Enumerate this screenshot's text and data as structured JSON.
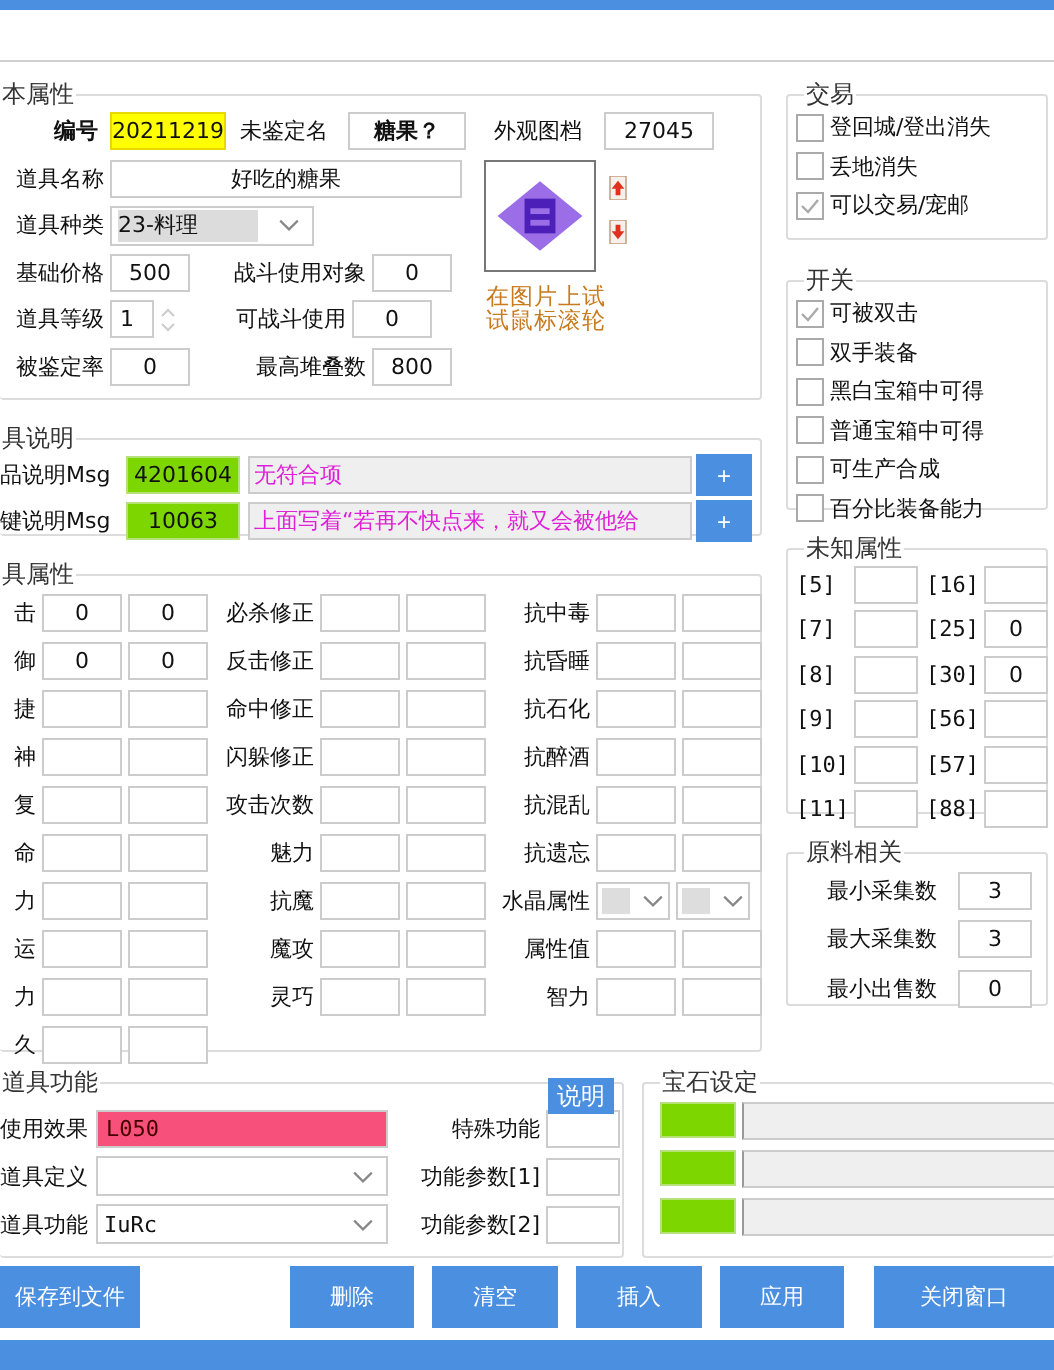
{
  "basic": {
    "title": "本属性",
    "id_label": "编号",
    "id": "20211219",
    "unidentified_label": "未鉴定名",
    "unidentified": "糖果？",
    "appearance_label": "外观图档",
    "appearance": "27045",
    "name_label": "道具名称",
    "name": "好吃的糖果",
    "type_label": "道具种类",
    "type": "23-料理",
    "price_label": "基础价格",
    "price": "500",
    "battle_target_label": "战斗使用对象",
    "battle_target": "0",
    "level_label": "道具等级",
    "level_value": "1",
    "battle_use_label": "可战斗使用",
    "battle_use": "0",
    "identify_rate_label": "被鉴定率",
    "identify_rate": "0",
    "max_stack_label": "最高堆叠数",
    "max_stack": "800",
    "image_hint": "在图片上试试鼠标滚轮"
  },
  "trade": {
    "title": "交易",
    "options": [
      {
        "label": "登回城/登出消失",
        "checked": false
      },
      {
        "label": "丢地消失",
        "checked": false
      },
      {
        "label": "可以交易/宠邮",
        "checked": true
      }
    ]
  },
  "switches": {
    "title": "开关",
    "options": [
      {
        "label": "可被双击",
        "checked": true
      },
      {
        "label": "双手装备",
        "checked": false
      },
      {
        "label": "黑白宝箱中可得",
        "checked": false
      },
      {
        "label": "普通宝箱中可得",
        "checked": false
      },
      {
        "label": "可生产合成",
        "checked": false
      },
      {
        "label": "百分比装备能力",
        "checked": false
      }
    ]
  },
  "description": {
    "title": "具说明",
    "rows": [
      {
        "label": "品说明Msg",
        "code": "4201604",
        "text": "无符合项",
        "button": "+"
      },
      {
        "label": "键说明Msg",
        "code": "10063",
        "text": "上面写着“若再不快点来，就又会被他给",
        "button": "+"
      }
    ]
  },
  "attributes": {
    "title": "具属性",
    "columns": [
      [
        {
          "label": "击",
          "values": [
            "0",
            "0"
          ]
        },
        {
          "label": "御",
          "values": [
            "0",
            "0"
          ]
        },
        {
          "label": "捷"
        },
        {
          "label": "神"
        },
        {
          "label": "复"
        },
        {
          "label": "命"
        },
        {
          "label": "力"
        },
        {
          "label": "运"
        },
        {
          "label": "力"
        },
        {
          "label": "久"
        }
      ],
      [
        {
          "label": "必杀修正"
        },
        {
          "label": "反击修正"
        },
        {
          "label": "命中修正"
        },
        {
          "label": "闪躲修正"
        },
        {
          "label": "攻击次数"
        },
        {
          "label": "魅力"
        },
        {
          "label": "抗魔"
        },
        {
          "label": "魔攻"
        },
        {
          "label": "灵巧"
        }
      ],
      [
        {
          "label": "抗中毒",
          "kind": "fields"
        },
        {
          "label": "抗昏睡",
          "kind": "fields"
        },
        {
          "label": "抗石化",
          "kind": "fields"
        },
        {
          "label": "抗醉酒",
          "kind": "fields"
        },
        {
          "label": "抗混乱",
          "kind": "fields"
        },
        {
          "label": "抗遗忘",
          "kind": "fields"
        },
        {
          "label": "水晶属性",
          "kind": "dropdowns"
        },
        {
          "label": "属性值",
          "kind": "fields"
        },
        {
          "label": "智力",
          "kind": "fields"
        }
      ]
    ]
  },
  "unknown": {
    "title": "未知属性",
    "items": [
      {
        "label": "[5]"
      },
      {
        "label": "[16]"
      },
      {
        "label": "[7]"
      },
      {
        "label": "[25]",
        "value": "0"
      },
      {
        "label": "[8]"
      },
      {
        "label": "[30]",
        "value": "0"
      },
      {
        "label": "[9]"
      },
      {
        "label": "[56]"
      },
      {
        "label": "[10]"
      },
      {
        "label": "[57]"
      },
      {
        "label": "[11]"
      },
      {
        "label": "[88]"
      }
    ]
  },
  "material": {
    "title": "原料相关",
    "rows": [
      {
        "label": "最小采集数",
        "value": "3"
      },
      {
        "label": "最大采集数",
        "value": "3"
      },
      {
        "label": "最小出售数",
        "value": "0"
      }
    ]
  },
  "function": {
    "title": "道具功能",
    "help_button": "说明",
    "rows": [
      {
        "kind": "text",
        "label": "使用效果",
        "value": "L050"
      },
      {
        "kind": "dropdown",
        "label": "道具定义"
      },
      {
        "kind": "dropdown",
        "label": "道具功能",
        "value": "IuRc"
      }
    ],
    "params": [
      {
        "label": "特殊功能"
      },
      {
        "label": "功能参数[1]"
      },
      {
        "label": "功能参数[2]"
      }
    ]
  },
  "gems": {
    "title": "宝石设定",
    "slots": [
      {
        "kind": "gem"
      },
      {
        "kind": "gem"
      },
      {
        "kind": "gem"
      }
    ]
  },
  "buttons": [
    {
      "label": "保存到文件",
      "kind": "left"
    },
    {
      "label": "删除",
      "kind": "action"
    },
    {
      "label": "清空",
      "kind": "action"
    },
    {
      "label": "插入",
      "kind": "action"
    },
    {
      "label": "应用",
      "kind": "action"
    },
    {
      "label": "关闭窗口",
      "kind": "close"
    }
  ]
}
